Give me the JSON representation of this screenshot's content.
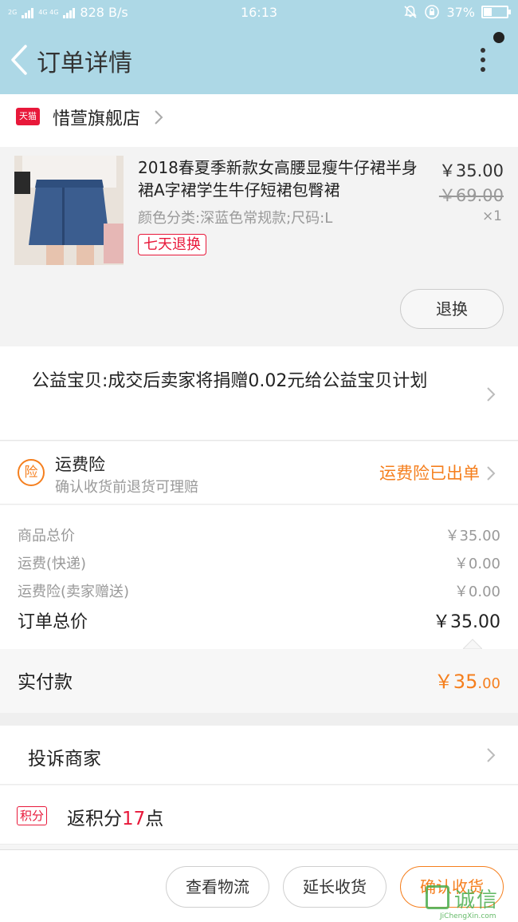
{
  "status_bar": {
    "network_1": "2G",
    "network_2": "4G 4G",
    "speed": "828 B/s",
    "time": "16:13",
    "battery": "37%",
    "battery_level": 0.37
  },
  "nav": {
    "title": "订单详情"
  },
  "shop": {
    "badge": "天猫",
    "name": "惜萱旗舰店"
  },
  "goods": {
    "title": "2018春夏季新款女高腰显瘦牛仔裙半身裙A字裙学生牛仔短裙包臀裙",
    "sku": "颜色分类:深蓝色常规款;尺码:L",
    "tag": "七天退换",
    "price": "￥35.00",
    "original_price": "￥69.00",
    "quantity": "×1",
    "refund_button": "退换"
  },
  "charity": {
    "text": "公益宝贝:成交后卖家将捐赠0.02元给公益宝贝计划"
  },
  "insurance": {
    "icon": "险",
    "title": "运费险",
    "subtitle": "确认收货前退货可理赔",
    "status": "运费险已出单"
  },
  "summary": {
    "items": [
      {
        "label": "商品总价",
        "value": "￥35.00"
      },
      {
        "label": "运费(快递)",
        "value": "￥0.00"
      },
      {
        "label": "运费险(卖家赠送)",
        "value": "￥0.00"
      }
    ],
    "total_label": "订单总价",
    "total_value": "￥35.00"
  },
  "payment": {
    "label": "实付款",
    "value_main": "￥35",
    "value_decimal": ".00"
  },
  "complain": {
    "label": "投诉商家"
  },
  "points": {
    "badge": "积分",
    "prefix": "返积分",
    "count": "17",
    "suffix": "点"
  },
  "actions": {
    "logistics": "查看物流",
    "extend": "延长收货",
    "confirm": "确认收货"
  },
  "watermark": {
    "text": "诚信",
    "sub": "JiChengXin.com"
  },
  "colors": {
    "nav_bg": "#add8e6",
    "accent_orange": "#f57f1e",
    "tmall_red": "#e8183a"
  }
}
